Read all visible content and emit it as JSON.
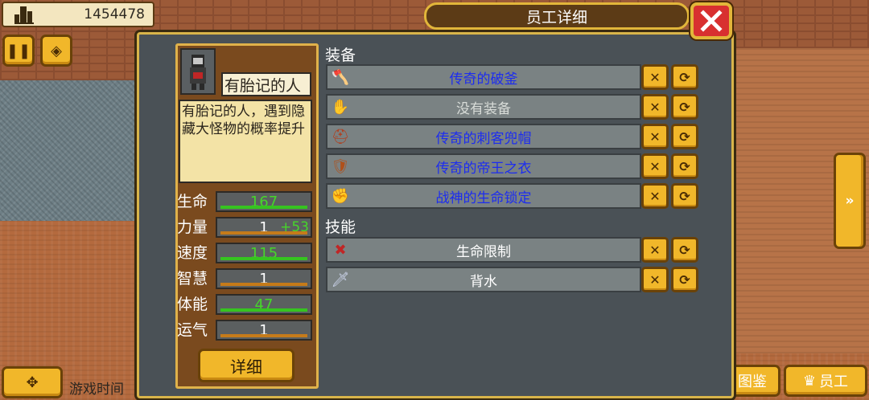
{
  "hud": {
    "money": "1454478",
    "game_time": "游戏时间",
    "bottom_buttons": {
      "codex": "图鉴",
      "staff": "员工"
    }
  },
  "dialog": {
    "title": "员工详细",
    "close": "✕"
  },
  "character": {
    "name": "有胎记的人",
    "description": "有胎记的人，遇到隐藏大怪物的概率提升",
    "stats": [
      {
        "label": "生命",
        "value": "167",
        "bonus": "",
        "level": 1.0,
        "highlight": true
      },
      {
        "label": "力量",
        "value": "1",
        "bonus": "+53",
        "level": 1.0,
        "highlight": false
      },
      {
        "label": "速度",
        "value": "115",
        "bonus": "",
        "level": 1.0,
        "highlight": true
      },
      {
        "label": "智慧",
        "value": "1",
        "bonus": "",
        "level": 1.0,
        "highlight": false
      },
      {
        "label": "体能",
        "value": "47",
        "bonus": "",
        "level": 1.0,
        "highlight": true
      },
      {
        "label": "运气",
        "value": "1",
        "bonus": "",
        "level": 1.0,
        "highlight": false
      }
    ],
    "detail_button": "详细"
  },
  "equipment": {
    "title": "装备",
    "items": [
      {
        "icon": "axe-icon",
        "label": "传奇的破釜",
        "color": "blue"
      },
      {
        "icon": "glove-icon",
        "label": "没有装备",
        "color": "grey"
      },
      {
        "icon": "hood-icon",
        "label": "传奇的刺客兜帽",
        "color": "blue"
      },
      {
        "icon": "armor-icon",
        "label": "传奇的帝王之衣",
        "color": "blue"
      },
      {
        "icon": "gauntlet-icon",
        "label": "战神的生命锁定",
        "color": "blue"
      }
    ]
  },
  "skills": {
    "title": "技能",
    "items": [
      {
        "icon": "hp-limit-icon",
        "label": "生命限制"
      },
      {
        "icon": "sword-icon",
        "label": "背水"
      }
    ]
  },
  "colors": {
    "accent_gold": "#f1b72a",
    "panel_bg": "#4a5156",
    "close_red": "#d83030",
    "legendary_blue": "#1c2cf0",
    "stat_green": "#46d62a"
  }
}
